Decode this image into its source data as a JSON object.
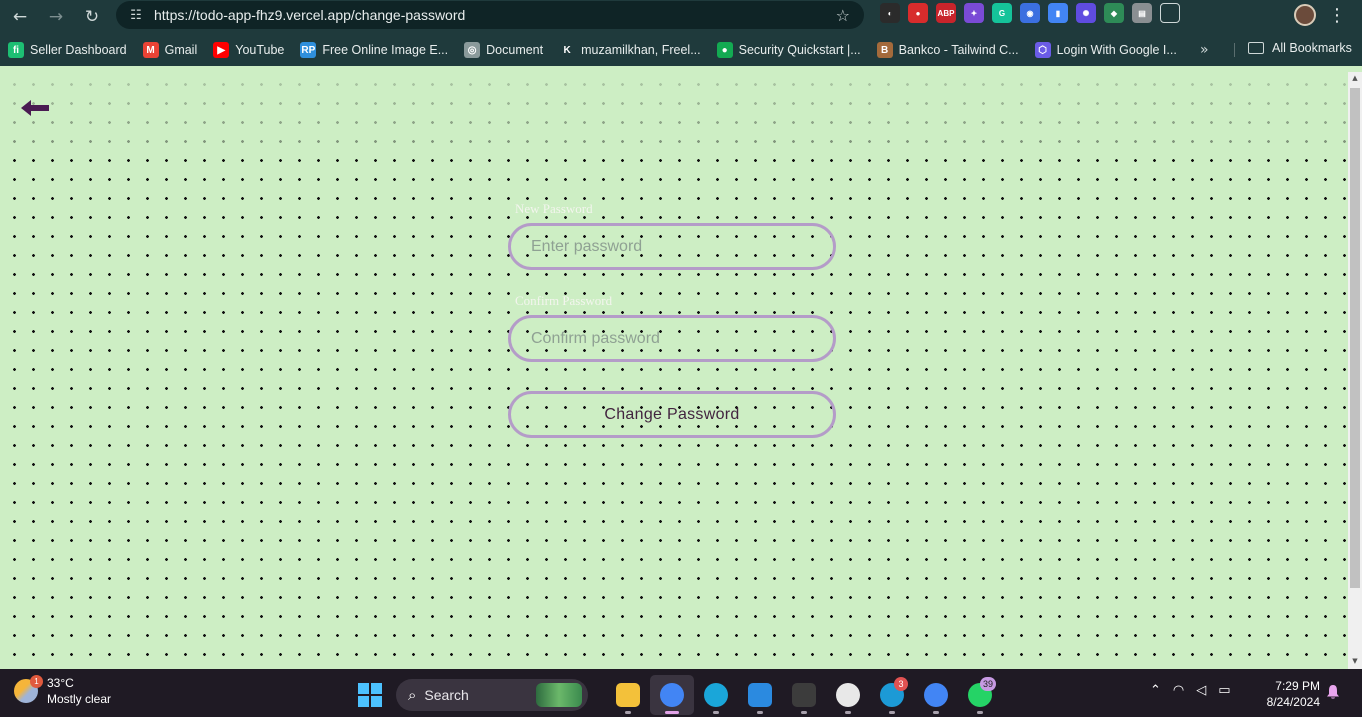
{
  "browser": {
    "url": "https://todo-app-fhz9.vercel.app/change-password",
    "bookmarks": [
      {
        "label": "Seller Dashboard",
        "icon": "fiverr-icon",
        "color": "#1dbf73",
        "glyph": "fi"
      },
      {
        "label": "Gmail",
        "icon": "gmail-icon",
        "color": "#ea4335",
        "glyph": "M"
      },
      {
        "label": "YouTube",
        "icon": "youtube-icon",
        "color": "#ff0000",
        "glyph": "▶"
      },
      {
        "label": "Free Online Image E...",
        "icon": "rp-icon",
        "color": "#2f8fdc",
        "glyph": "RP"
      },
      {
        "label": "Document",
        "icon": "globe-icon",
        "color": "#8a9a9b",
        "glyph": "◎"
      },
      {
        "label": "muzamilkhan, Freel...",
        "icon": "k-icon",
        "color": "#1f3a3c",
        "glyph": "K"
      },
      {
        "label": "Security Quickstart |...",
        "icon": "mongodb-icon",
        "color": "#13aa52",
        "glyph": "●"
      },
      {
        "label": "Bankco - Tailwind C...",
        "icon": "bankco-icon",
        "color": "#a46a3b",
        "glyph": "B"
      },
      {
        "label": "Login With Google I...",
        "icon": "hexagon-icon",
        "color": "#6b5ce7",
        "glyph": "⬡"
      }
    ],
    "all_bookmarks": "All Bookmarks",
    "extensions": [
      {
        "name": "circle-ext-icon",
        "color": "#2b2b2b",
        "glyph": "◐"
      },
      {
        "name": "red-ext-icon",
        "color": "#d72c2c",
        "glyph": "●"
      },
      {
        "name": "abp-icon",
        "color": "#c8242b",
        "glyph": "ABP"
      },
      {
        "name": "color-picker-icon",
        "color": "#7a4bd6",
        "glyph": "✦"
      },
      {
        "name": "grammarly-icon",
        "color": "#15c39a",
        "glyph": "G"
      },
      {
        "name": "blue-ext-icon",
        "color": "#3b6fe0",
        "glyph": "◉"
      },
      {
        "name": "document-ext-icon",
        "color": "#4285f4",
        "glyph": "▮"
      },
      {
        "name": "sparkle-ext-icon",
        "color": "#5f4ce0",
        "glyph": "✺"
      },
      {
        "name": "drive-ext-icon",
        "color": "#2e8b57",
        "glyph": "◆"
      },
      {
        "name": "printer-ext-icon",
        "color": "#8a8f92",
        "glyph": "▤"
      }
    ]
  },
  "page": {
    "new_password_label": "New Password",
    "new_password_placeholder": "Enter password",
    "confirm_password_label": "Confirm Password",
    "confirm_password_placeholder": "Confirm password",
    "submit_label": "Change Password",
    "colors": {
      "background": "#cdeec4",
      "input_border": "#b49cc8",
      "back_arrow": "#4a1b52",
      "button_text": "#42243f"
    }
  },
  "taskbar": {
    "temperature": "33°C",
    "weather": "Mostly clear",
    "weather_badge": "1",
    "search_label": "Search",
    "apps": [
      {
        "name": "file-explorer-icon",
        "color": "#f3c13a",
        "badge": "",
        "active": false
      },
      {
        "name": "chrome-icon",
        "color": "#4285f4",
        "badge": "",
        "active": true
      },
      {
        "name": "edge-icon",
        "color": "#1aa6d9",
        "badge": "",
        "active": false
      },
      {
        "name": "vscode-icon",
        "color": "#2b8ae0",
        "badge": "",
        "active": false
      },
      {
        "name": "terminal-icon",
        "color": "#3c3c3c",
        "badge": "",
        "active": false
      },
      {
        "name": "clock-app-icon",
        "color": "#e8e8e8",
        "badge": "",
        "active": false
      },
      {
        "name": "skype-icon",
        "color": "#1c9ad6",
        "badge": "3",
        "active": false
      },
      {
        "name": "chrome-profile-icon",
        "color": "#4285f4",
        "badge": "",
        "active": false
      },
      {
        "name": "whatsapp-icon",
        "color": "#25d366",
        "badge": "39",
        "active": false
      }
    ],
    "time": "7:29 PM",
    "date": "8/24/2024"
  }
}
